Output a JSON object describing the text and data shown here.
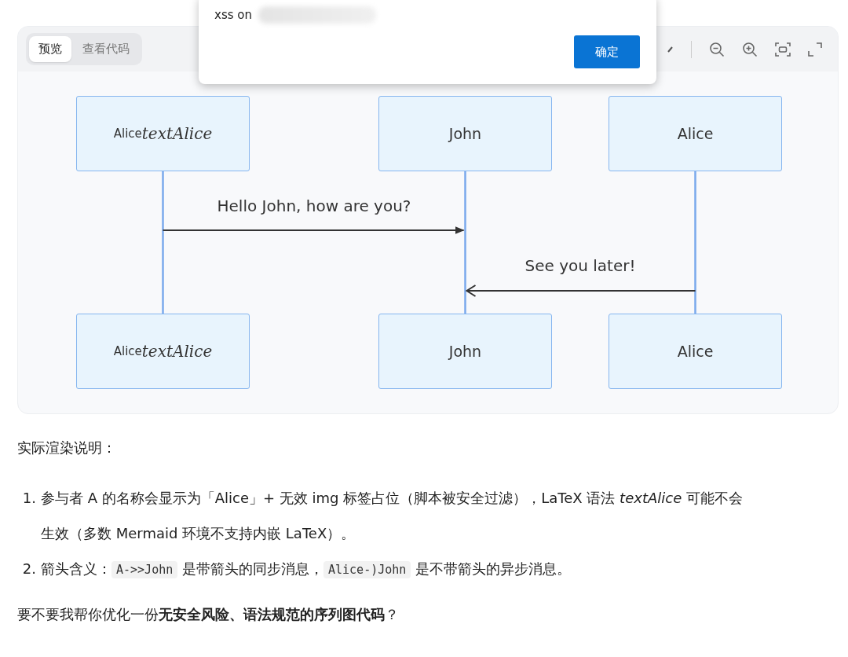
{
  "dialog": {
    "message": "xss on",
    "redacted": true,
    "button": "确定"
  },
  "viewer": {
    "tabs": [
      {
        "label": "预览",
        "selected": true
      },
      {
        "label": "查看代码",
        "selected": false
      }
    ],
    "participant_heads": [
      {
        "text": "Alice",
        "math": "textAlice"
      },
      {
        "text": "John"
      },
      {
        "text": "Alice"
      }
    ],
    "participant_feet": [
      {
        "text": "Alice",
        "math": "textAlice"
      },
      {
        "text": "John"
      },
      {
        "text": "Alice"
      }
    ],
    "messages": [
      {
        "text": "Hello John, how are you?",
        "kind": "sync"
      },
      {
        "text": "See you later!",
        "kind": "async"
      }
    ]
  },
  "notes": {
    "heading": "实际渲染说明：",
    "items": [
      {
        "number": "1.",
        "segments": [
          {
            "kind": "text",
            "text": "参与者 A 的名称会显示为「Alice」+ 无效 img 标签占位（脚本被安全过滤），LaTeX 语法 *textAlice* 可能不会生效（多数 Mermaid 环境不支持内嵌 LaTeX）。"
          }
        ]
      },
      {
        "number": "2.",
        "segments": [
          {
            "kind": "text",
            "text": "箭头含义："
          },
          {
            "kind": "code",
            "text": "A->>John"
          },
          {
            "kind": "text",
            "text": " 是带箭头的同步消息，"
          },
          {
            "kind": "code",
            "text": "Alice-)John"
          },
          {
            "kind": "text",
            "text": " 是不带箭头的异步消息。"
          }
        ]
      }
    ],
    "question": "要不要我帮你优化一份**无安全风险、语法规范的序列图代码**？"
  }
}
